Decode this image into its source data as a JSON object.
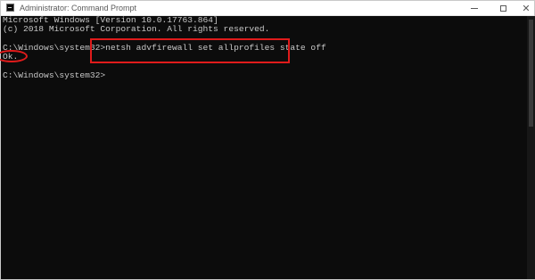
{
  "window": {
    "title": "Administrator: Command Prompt",
    "icon": "cmd-icon",
    "controls": {
      "minimize": "minimize-icon",
      "maximize": "maximize-icon",
      "close": "close-icon",
      "close_glyph": "✕"
    }
  },
  "console": {
    "lines": [
      "Microsoft Windows [Version 10.0.17763.864]",
      "(c) 2018 Microsoft Corporation. All rights reserved.",
      "",
      "C:\\Windows\\system32>netsh advfirewall set allprofiles state off",
      "Ok.",
      "",
      "C:\\Windows\\system32>"
    ]
  },
  "annotations": {
    "highlight_color": "#e01b1b"
  },
  "colors": {
    "console_bg": "#0c0c0c",
    "console_text": "#c8c8c8",
    "titlebar_bg": "#ffffff"
  }
}
